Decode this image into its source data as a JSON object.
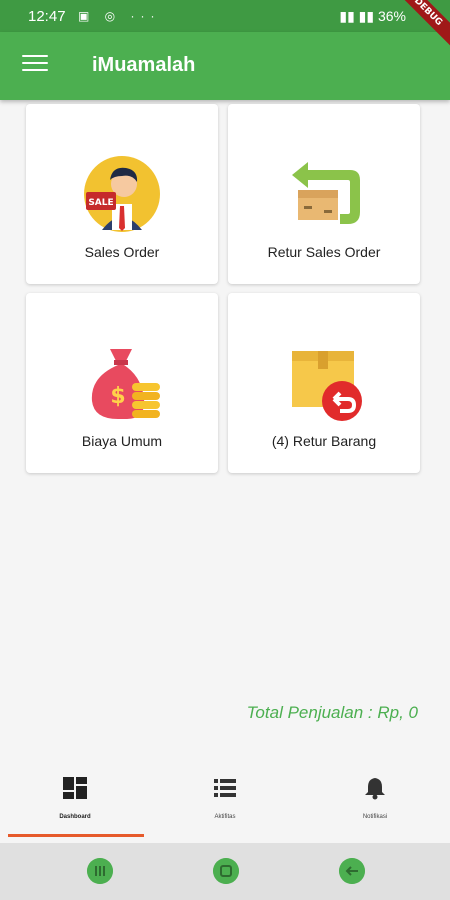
{
  "status_bar": {
    "time": "12:47",
    "battery": "36%"
  },
  "debug_banner": "DEBUG",
  "app_bar": {
    "title": "iMuamalah"
  },
  "cards": [
    {
      "label": "Sales Order",
      "icon": "salesman-icon",
      "badge": "SALE"
    },
    {
      "label": "Retur Sales Order",
      "icon": "return-box-icon"
    },
    {
      "label": "Biaya Umum",
      "icon": "money-bag-icon",
      "badge": "$"
    },
    {
      "label": "(4) Retur Barang",
      "icon": "box-return-icon"
    }
  ],
  "total": "Total Penjualan : Rp, 0",
  "bottom_nav": [
    {
      "label": "Dashboard",
      "icon": "dashboard-icon",
      "active": true
    },
    {
      "label": "Aktifitas",
      "icon": "list-icon",
      "active": false
    },
    {
      "label": "Notifikasi",
      "icon": "bell-icon",
      "active": false
    }
  ],
  "colors": {
    "primary": "#4caf50",
    "status_bar": "#3f9a43",
    "indicator": "#e65a2b",
    "debug": "#a01818"
  }
}
